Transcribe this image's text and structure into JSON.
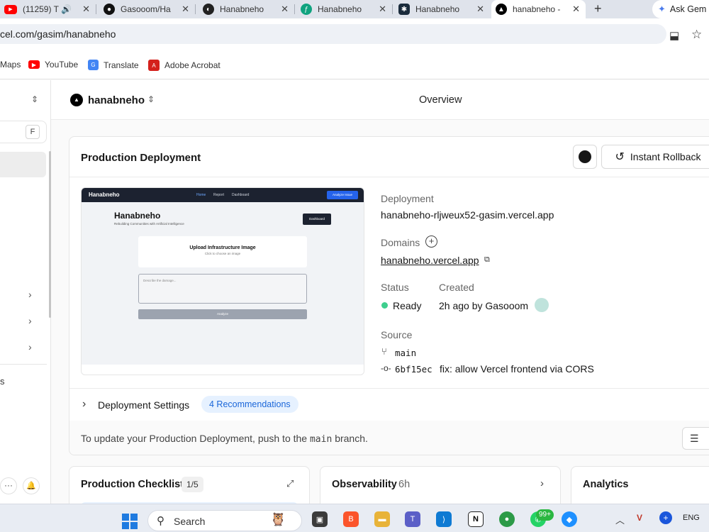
{
  "browser": {
    "tabs": [
      {
        "title": "(11259) T",
        "icon": "youtube-icon",
        "color": "#ff0000"
      },
      {
        "title": "Gasooom/Ha",
        "icon": "github-icon",
        "color": "#111111"
      },
      {
        "title": "Hanabneho",
        "icon": "app-icon",
        "color": "#222222"
      },
      {
        "title": "Hanabneho",
        "icon": "feather-icon",
        "color": "#10a37f"
      },
      {
        "title": "Hanabneho",
        "icon": "cube-icon",
        "color": "#1a2b3c"
      },
      {
        "title": "hanabneho -",
        "icon": "vercel-icon",
        "color": "#000000"
      }
    ],
    "new_tab": "+",
    "ask_gemini": "Ask Gem",
    "url": "cel.com/gasim/hanabneho",
    "bookmarks": [
      {
        "label": "Maps"
      },
      {
        "label": "YouTube",
        "color": "#ff0000"
      },
      {
        "label": "Translate",
        "color": "#4285f4"
      },
      {
        "label": "Adobe Acrobat",
        "color": "#d4211c"
      }
    ]
  },
  "sidebar": {
    "search_shortcut": "F",
    "partial_label": "s"
  },
  "header": {
    "project_name": "hanabneho",
    "page_title": "Overview"
  },
  "deployment": {
    "section_title": "Production Deployment",
    "rollback_label": "Instant Rollback",
    "deployment_label": "Deployment",
    "deployment_url": "hanabneho-rljweux52-gasim.vercel.app",
    "domains_label": "Domains",
    "domain": "hanabneho.vercel.app",
    "status_label": "Status",
    "status_value": "Ready",
    "status_color": "#3ecf8e",
    "created_label": "Created",
    "created_value": "2h ago by Gasooom",
    "source_label": "Source",
    "branch": "main",
    "commit_hash": "6bf15ec",
    "commit_message": "fix: allow Vercel frontend via CORS",
    "settings_label": "Deployment Settings",
    "recommendations": "4 Recommendations",
    "update_text_pre": "To update your Production Deployment, push to the",
    "update_branch": "main",
    "update_text_post": "branch."
  },
  "preview": {
    "brand": "Hanabneho",
    "nav": [
      "Home",
      "Report",
      "Dashboard"
    ],
    "nav_button": "Analyze Issue",
    "title": "Hanabneho",
    "subtitle": "Rebuilding Communities with Artificial Intelligence",
    "dashboard_btn": "Dashboard",
    "upload_title": "Upload Infrastructure Image",
    "upload_sub": "Click to choose an image",
    "textarea_placeholder": "Describe the damage...",
    "analyze_btn": "Analyze"
  },
  "cards": {
    "checklist_title": "Production Checklist",
    "checklist_progress": "1/5",
    "observability_title": "Observability",
    "observability_range": "6h",
    "analytics_title": "Analytics"
  },
  "taskbar": {
    "search_label": "Search",
    "notif_badge": "99+",
    "lang": "ENG"
  }
}
